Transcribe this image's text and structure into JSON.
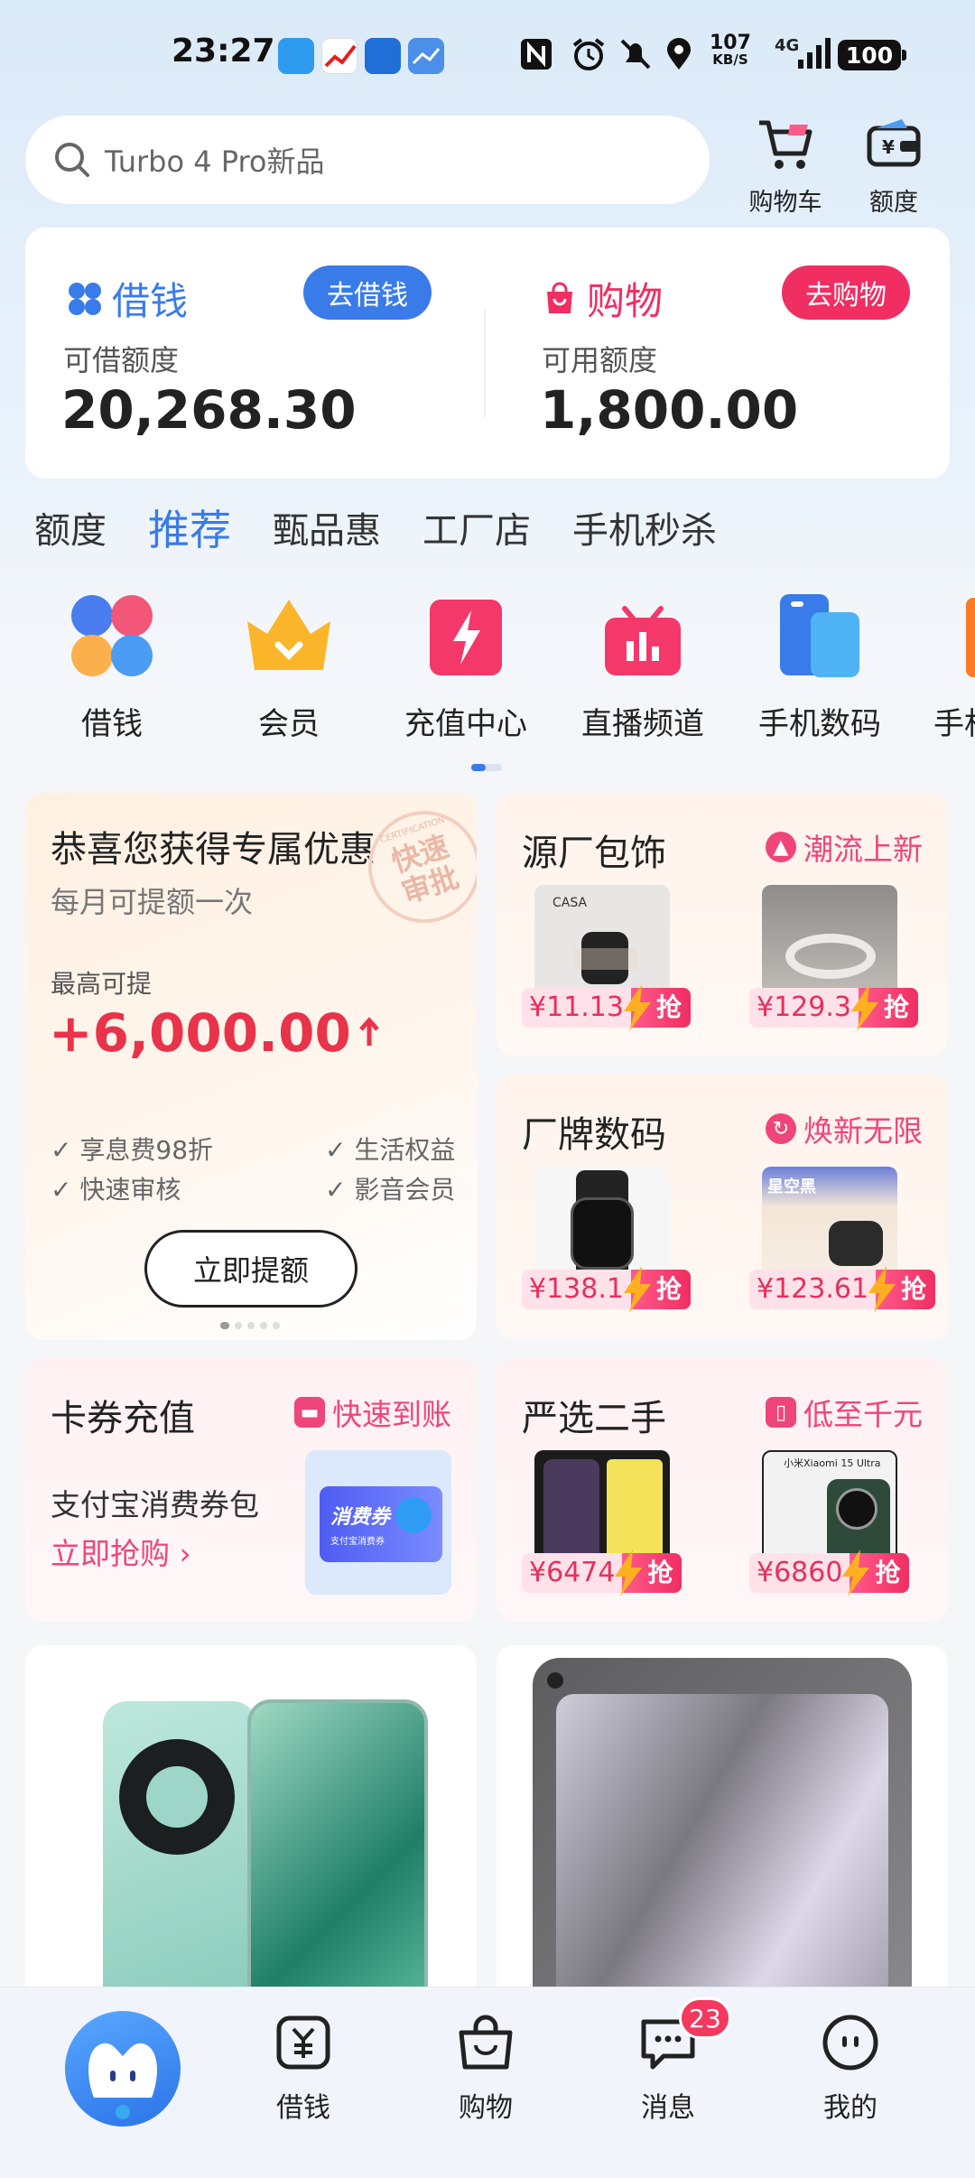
{
  "status_bar": {
    "time": "23:27",
    "speed_value": "107",
    "speed_unit": "KB/S",
    "network": "4G",
    "battery": "100"
  },
  "search": {
    "placeholder": "Turbo 4 Pro新品"
  },
  "header_icons": {
    "cart_label": "购物车",
    "quota_label": "额度"
  },
  "finance": {
    "loan": {
      "title": "借钱",
      "button": "去借钱",
      "sub_label": "可借额度",
      "amount": "20,268.30"
    },
    "shop": {
      "title": "购物",
      "button": "去购物",
      "sub_label": "可用额度",
      "amount": "1,800.00"
    }
  },
  "tabs": [
    {
      "label": "额度",
      "active": false
    },
    {
      "label": "推荐",
      "active": true
    },
    {
      "label": "甄品惠",
      "active": false
    },
    {
      "label": "工厂店",
      "active": false
    },
    {
      "label": "手机秒杀",
      "active": false
    }
  ],
  "quick_links": [
    {
      "label": "借钱",
      "icon": "clover-icon"
    },
    {
      "label": "会员",
      "icon": "crown-icon"
    },
    {
      "label": "充值中心",
      "icon": "lightning-icon"
    },
    {
      "label": "直播频道",
      "icon": "tv-icon"
    },
    {
      "label": "手机数码",
      "icon": "phones-icon"
    },
    {
      "label": "手机",
      "icon": "phone-icon"
    }
  ],
  "offer_card": {
    "title": "恭喜您获得专属优惠",
    "subtitle": "每月可提额一次",
    "stamp": "快速审批",
    "stamp_small": "CERTIFICATION",
    "max_label": "最高可提",
    "amount": "+6,000.00",
    "benefits": [
      "享息费98折",
      "生活权益",
      "快速审核",
      "影音会员"
    ],
    "button": "立即提额"
  },
  "bags_card": {
    "title": "源厂包饰",
    "tag": "潮流上新",
    "products": [
      {
        "price": "¥11.13",
        "cta": "抢",
        "brand": "CASA"
      },
      {
        "price": "¥129.3",
        "cta": "抢"
      }
    ]
  },
  "digital_card": {
    "title": "厂牌数码",
    "tag": "焕新无限",
    "products": [
      {
        "price": "¥138.1",
        "cta": "抢"
      },
      {
        "price": "¥123.61",
        "cta": "抢",
        "brand": "星空黑"
      }
    ]
  },
  "recharge_card": {
    "title": "卡券充值",
    "tag": "快速到账",
    "desc": "支付宝消费券包",
    "link": "立即抢购",
    "coupon_text": "消费券",
    "coupon_sub": "支付宝消费券"
  },
  "used_card": {
    "title": "严选二手",
    "tag": "低至千元",
    "products": [
      {
        "price": "¥6474",
        "cta": "抢"
      },
      {
        "price": "¥6860",
        "cta": "抢",
        "brand": "小米Xiaomi 15 Ultra"
      }
    ]
  },
  "bottom_nav": {
    "items": [
      {
        "label": "借钱"
      },
      {
        "label": "购物"
      },
      {
        "label": "消息"
      },
      {
        "label": "我的"
      }
    ],
    "message_badge": "23"
  },
  "colors": {
    "accent_blue": "#3a7bea",
    "accent_pink": "#f02e62",
    "price_red": "#e6305c",
    "offer_red": "#e8334a"
  }
}
